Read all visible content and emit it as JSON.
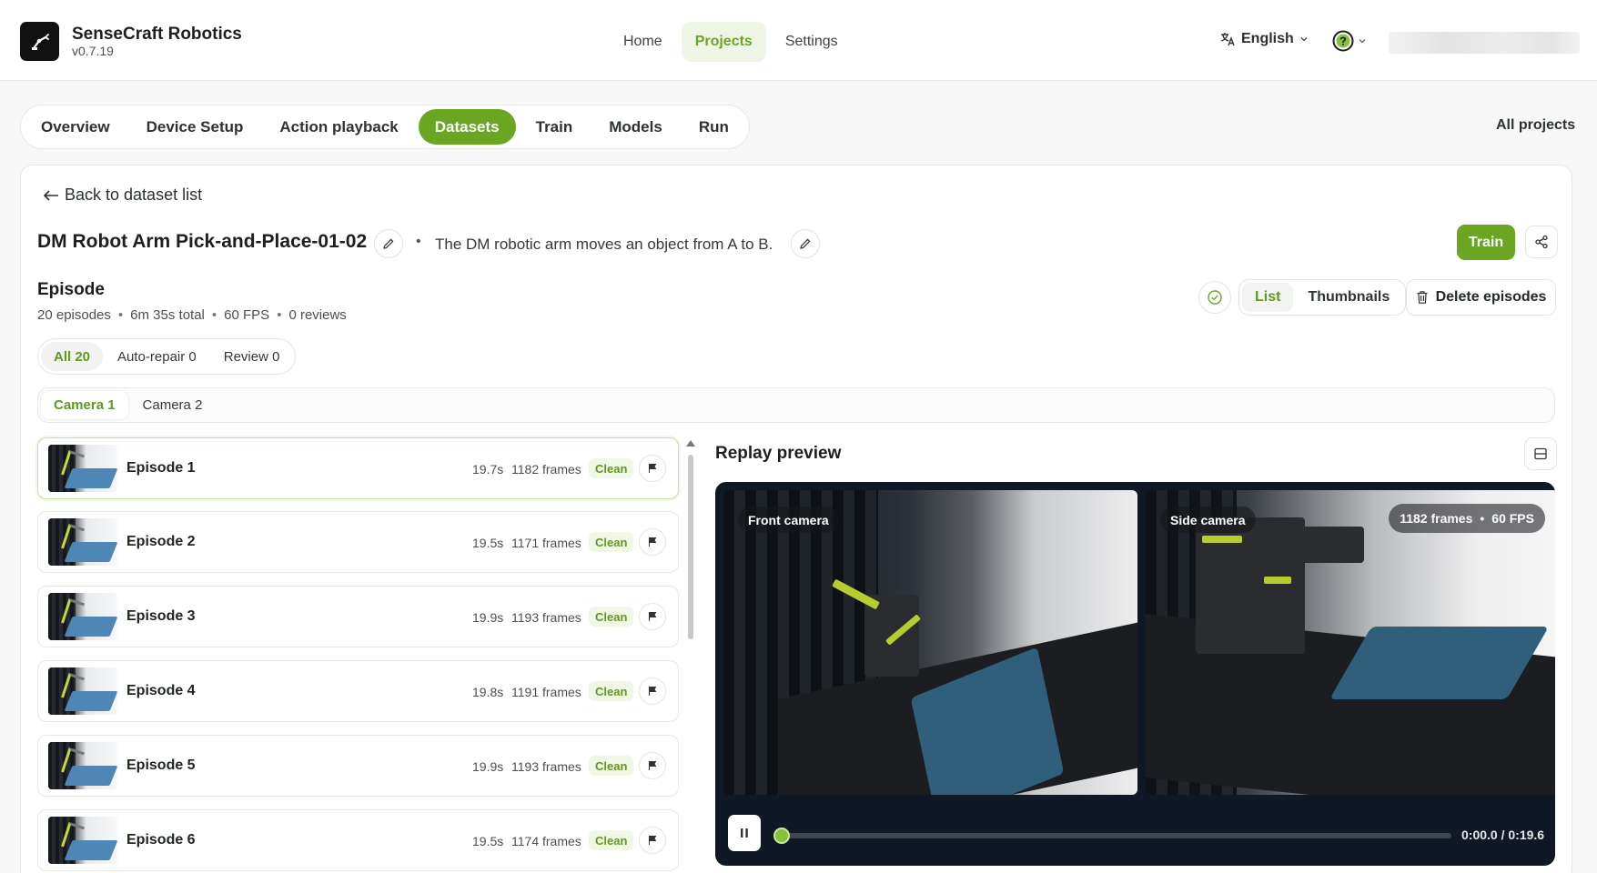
{
  "brand": {
    "name": "SenseCraft Robotics",
    "version": "v0.7.19"
  },
  "nav": [
    {
      "label": "Home",
      "active": false
    },
    {
      "label": "Projects",
      "active": true
    },
    {
      "label": "Settings",
      "active": false
    }
  ],
  "language": "English",
  "tabs": [
    {
      "label": "Overview",
      "active": false
    },
    {
      "label": "Device Setup",
      "active": false
    },
    {
      "label": "Action playback",
      "active": false
    },
    {
      "label": "Datasets",
      "active": true
    },
    {
      "label": "Train",
      "active": false
    },
    {
      "label": "Models",
      "active": false
    },
    {
      "label": "Run",
      "active": false
    }
  ],
  "all_projects": "All projects",
  "back_label": "Back to dataset list",
  "dataset": {
    "title": "DM Robot Arm Pick-and-Place-01-02",
    "description": "The DM robotic arm moves an object from A to B.",
    "train_label": "Train"
  },
  "episodes_panel": {
    "heading": "Episode",
    "stats": [
      "20 episodes",
      "6m 35s total",
      "60 FPS",
      "0 reviews"
    ],
    "view_modes": [
      {
        "label": "List",
        "active": true
      },
      {
        "label": "Thumbnails",
        "active": false
      }
    ],
    "delete_label": "Delete episodes",
    "filters": [
      {
        "label": "All 20",
        "active": true
      },
      {
        "label": "Auto-repair 0",
        "active": false
      },
      {
        "label": "Review 0",
        "active": false
      }
    ],
    "cameras": [
      {
        "label": "Camera 1",
        "active": true
      },
      {
        "label": "Camera 2",
        "active": false
      }
    ],
    "items": [
      {
        "name": "Episode 1",
        "duration": "19.7s",
        "frames": "1182 frames",
        "status": "Clean",
        "selected": true
      },
      {
        "name": "Episode 2",
        "duration": "19.5s",
        "frames": "1171 frames",
        "status": "Clean",
        "selected": false
      },
      {
        "name": "Episode 3",
        "duration": "19.9s",
        "frames": "1193 frames",
        "status": "Clean",
        "selected": false
      },
      {
        "name": "Episode 4",
        "duration": "19.8s",
        "frames": "1191 frames",
        "status": "Clean",
        "selected": false
      },
      {
        "name": "Episode 5",
        "duration": "19.9s",
        "frames": "1193 frames",
        "status": "Clean",
        "selected": false
      },
      {
        "name": "Episode 6",
        "duration": "19.5s",
        "frames": "1174 frames",
        "status": "Clean",
        "selected": false
      }
    ]
  },
  "replay": {
    "title": "Replay preview",
    "front_label": "Front camera",
    "side_label": "Side camera",
    "frames_badge": "1182 frames",
    "fps_badge": "60 FPS",
    "time": "0:00.0 / 0:19.6",
    "progress": 0.0
  },
  "colors": {
    "accent": "#6aa621",
    "player_bg": "#0f1824"
  }
}
